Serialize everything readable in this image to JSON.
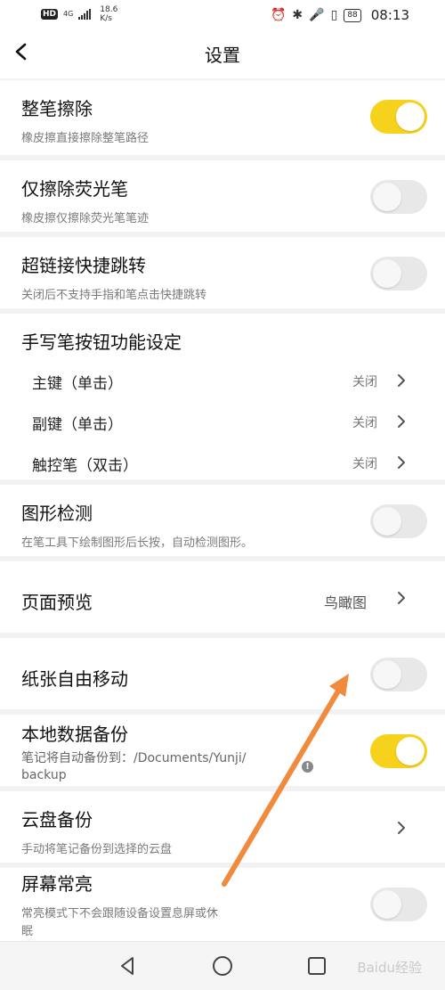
{
  "status_bar": {
    "hd": "HD",
    "net": "4G",
    "speed_value": "18.6",
    "speed_unit": "K/s",
    "battery": "88",
    "time": "08:13"
  },
  "header": {
    "title": "设置",
    "back_icon": "chevron-left-icon"
  },
  "settings": {
    "whole_erase": {
      "title": "整笔擦除",
      "subtitle": "橡皮擦直接擦除整笔路径",
      "enabled": true
    },
    "highlighter_erase": {
      "title": "仅擦除荧光笔",
      "subtitle": "橡皮擦仅擦除荧光笔笔迹",
      "enabled": false
    },
    "hyperlink_jump": {
      "title": "超链接快捷跳转",
      "subtitle": "关闭后不支持手指和笔点击快捷跳转",
      "enabled": false
    },
    "pen_button": {
      "title": "手写笔按钮功能设定",
      "items": [
        {
          "label": "主键（单击）",
          "value": "关闭"
        },
        {
          "label": "副键（单击）",
          "value": "关闭"
        },
        {
          "label": "触控笔（双击）",
          "value": "关闭"
        }
      ]
    },
    "shape_detect": {
      "title": "图形检测",
      "subtitle": "在笔工具下绘制图形后长按，自动检测图形。",
      "enabled": false
    },
    "page_preview": {
      "title": "页面预览",
      "value": "鸟瞰图"
    },
    "paper_move": {
      "title": "纸张自由移动",
      "enabled": false
    },
    "local_backup": {
      "title": "本地数据备份",
      "subtitle_line1": "笔记将自动备份到：/Documents/Yunji/",
      "subtitle_line2": "backup",
      "enabled": true
    },
    "cloud_backup": {
      "title": "云盘备份",
      "subtitle": "手动将笔记备份到选择的云盘"
    },
    "screen_on": {
      "title": "屏幕常亮",
      "subtitle_line1": "常亮模式下不会跟随设备设置息屏或休",
      "subtitle_line2": "眠",
      "enabled": false
    }
  },
  "navbar": {
    "back": "triangle-back-icon",
    "home": "circle-home-icon",
    "recents": "square-recents-icon",
    "watermark": "Baidu经验"
  },
  "colors": {
    "toggle_on": "#f7d21c",
    "toggle_off": "#e8e8e8",
    "annotation_arrow": "#f08a3c"
  }
}
